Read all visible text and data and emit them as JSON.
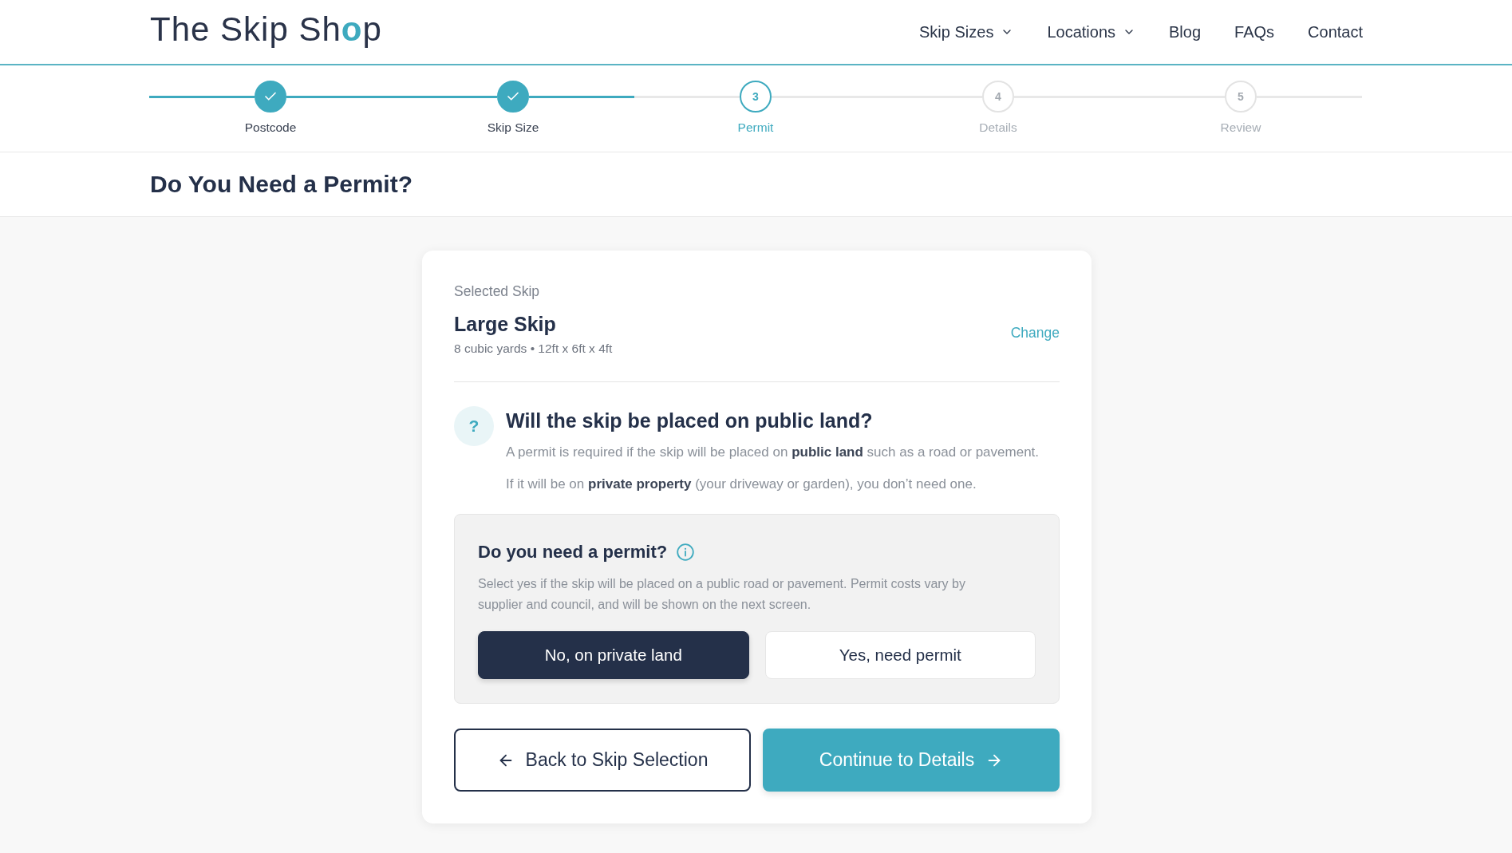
{
  "header": {
    "logo": [
      {
        "text": "The Skip Sh",
        "kind": "plain"
      },
      {
        "text": "o",
        "kind": "accent"
      },
      {
        "text": "p",
        "kind": "plain"
      }
    ],
    "nav": [
      {
        "label": "Skip Sizes",
        "has_menu": true
      },
      {
        "label": "Locations",
        "has_menu": true
      },
      {
        "label": "Blog",
        "has_menu": false
      },
      {
        "label": "FAQs",
        "has_menu": false
      },
      {
        "label": "Contact",
        "has_menu": false
      }
    ]
  },
  "steps": [
    {
      "label": "Postcode",
      "done": true,
      "current": false
    },
    {
      "label": "Skip Size",
      "done": true,
      "current": false
    },
    {
      "label": "Permit",
      "number": "3",
      "done": false,
      "current": true
    },
    {
      "label": "Details",
      "number": "4",
      "done": false,
      "current": false
    },
    {
      "label": "Review",
      "number": "5",
      "done": false,
      "current": false
    }
  ],
  "page_title": "Do You Need a Permit?",
  "selected_skip": {
    "caption": "Selected Skip",
    "name": "Large Skip",
    "details": "8 cubic yards • 12ft x 6ft x 4ft",
    "change_link": "Change"
  },
  "question": {
    "badge": "?",
    "heading": "Will the skip be placed on public land?",
    "paragraphs": [
      "A permit is required if the skip will be placed on **public land** such as a road or pavement.",
      "If it will be on **private property** (your driveway or garden), you don’t need one."
    ]
  },
  "permit": {
    "heading": "Do you need a permit?",
    "help": "Select yes if the skip will be placed on a public road or pavement. Permit costs vary by supplier and council, and will be shown on the next screen.",
    "options": [
      {
        "label": "No, on private land",
        "selected": true
      },
      {
        "label": "Yes, need permit",
        "selected": false
      }
    ]
  },
  "actions": [
    {
      "label": "Back to Skip Selection",
      "kind": "back"
    },
    {
      "label": "Continue to Details",
      "kind": "next"
    }
  ]
}
